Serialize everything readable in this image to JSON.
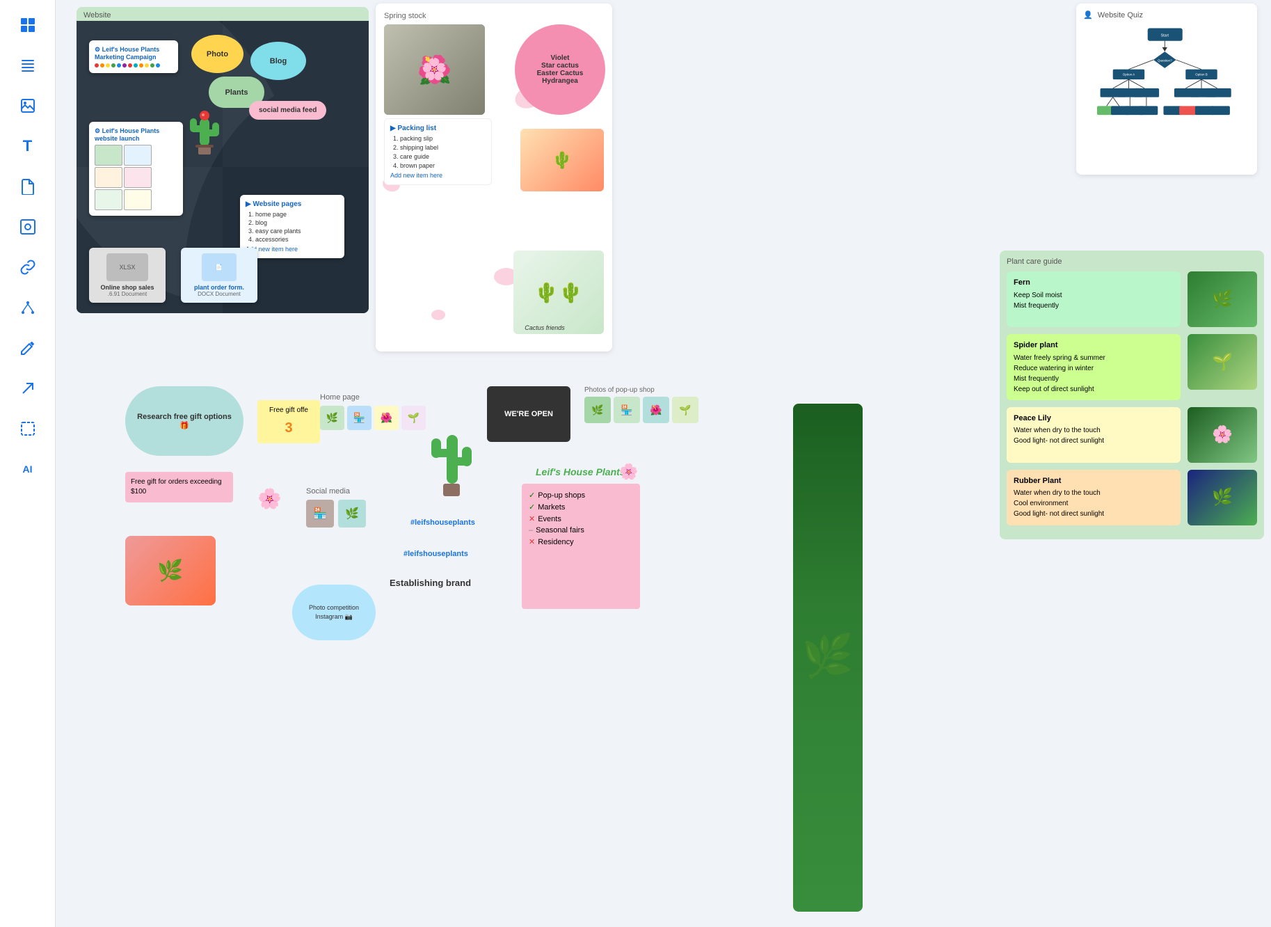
{
  "sidebar": {
    "tools": [
      {
        "name": "board-tool",
        "icon": "⊞",
        "label": "Board"
      },
      {
        "name": "list-tool",
        "icon": "☰",
        "label": "List"
      },
      {
        "name": "image-tool",
        "icon": "🖼",
        "label": "Image"
      },
      {
        "name": "text-tool",
        "icon": "T",
        "label": "Text"
      },
      {
        "name": "doc-tool",
        "icon": "📄",
        "label": "Document"
      },
      {
        "name": "frame-tool",
        "icon": "⬛",
        "label": "Frame"
      },
      {
        "name": "link-tool",
        "icon": "🔗",
        "label": "Link"
      },
      {
        "name": "network-tool",
        "icon": "⬡",
        "label": "Network"
      },
      {
        "name": "pencil-tool",
        "icon": "✏",
        "label": "Pencil"
      },
      {
        "name": "arrow-tool",
        "icon": "↗",
        "label": "Arrow"
      },
      {
        "name": "select-tool",
        "icon": "⬜",
        "label": "Select"
      },
      {
        "name": "ai-tool",
        "icon": "AI",
        "label": "AI"
      }
    ]
  },
  "website_section": {
    "label": "Website",
    "marketing_card": {
      "title": "Leif's House Plants Marketing Campaign",
      "icon": "⚙"
    },
    "blobs": {
      "photo": "Photo",
      "blog": "Blog",
      "plants": "Plants"
    },
    "website_launch": {
      "title": "Leif's House Plants website launch"
    },
    "social_feed": "social media feed",
    "website_pages": {
      "title": "Website pages",
      "items": [
        "home page",
        "blog",
        "easy care plants",
        "accessories"
      ]
    },
    "shop_card": {
      "title": "Online shop sales",
      "sub": ".6.91 Document"
    },
    "order_card": {
      "title": "plant order form.",
      "sub": "DOCX Document"
    }
  },
  "spring_section": {
    "label": "Spring stock",
    "violet_bubble": {
      "lines": [
        "Violet",
        "Star cactus",
        "Easter Cactus",
        "Hydrangea"
      ]
    },
    "packing_list": {
      "title": "Packing list",
      "items": [
        "packing slip",
        "shipping label",
        "care guide",
        "brown paper"
      ]
    },
    "cactus_friends_label": "Cactus friends"
  },
  "quiz_section": {
    "label": "Website Quiz"
  },
  "care_section": {
    "label": "Plant care guide",
    "plants": [
      {
        "name": "Fern",
        "care": "Keep Soil moist\nMist frequently",
        "bg": "#b9f6ca",
        "img_emoji": "🌿"
      },
      {
        "name": "Spider plant",
        "care": "Water freely spring & summer\nReduce watering in winter\nMist frequently\nKeep out of direct sunlight",
        "bg": "#ccff90",
        "img_emoji": "🌱"
      },
      {
        "name": "Peace Lily",
        "care": "Water when dry to the touch\nGood light- not direct sunlight",
        "bg": "#fff9c4",
        "img_emoji": "🌸"
      },
      {
        "name": "Rubber Plant",
        "care": "Water when dry to the touch\nCool environment\nGood light- not direct sunlight",
        "bg": "#ffe0b2",
        "img_emoji": "🌿"
      }
    ]
  },
  "research_bubble": {
    "text": "Research free gift options 🎁"
  },
  "gift_sticky": {
    "label": "Free gift offe",
    "number": "3"
  },
  "gift_orders_sticky": {
    "text": "Free gift for orders exceeding $100"
  },
  "homepage_section": {
    "label": "Home page"
  },
  "social_section": {
    "label": "Social media"
  },
  "hashtags": {
    "tag1": "#leifshouseplants",
    "tag2": "#leifshouseplants"
  },
  "leif_brand": "Leif's House Plants",
  "establishing": "Establishing brand",
  "popup_sticky": {
    "items": [
      {
        "text": "Pop-up shops",
        "status": "check"
      },
      {
        "text": "Markets",
        "status": "check"
      },
      {
        "text": "Events",
        "status": "cross"
      },
      {
        "text": "Seasonal fairs",
        "status": "none"
      },
      {
        "text": "Residency",
        "status": "cross"
      }
    ]
  },
  "open_sign": "WE'RE\nOPEN",
  "popup_photos_label": "Photos of pop-up shop",
  "photo_competition": {
    "text": "Photo competition\nInstagram 📷"
  }
}
